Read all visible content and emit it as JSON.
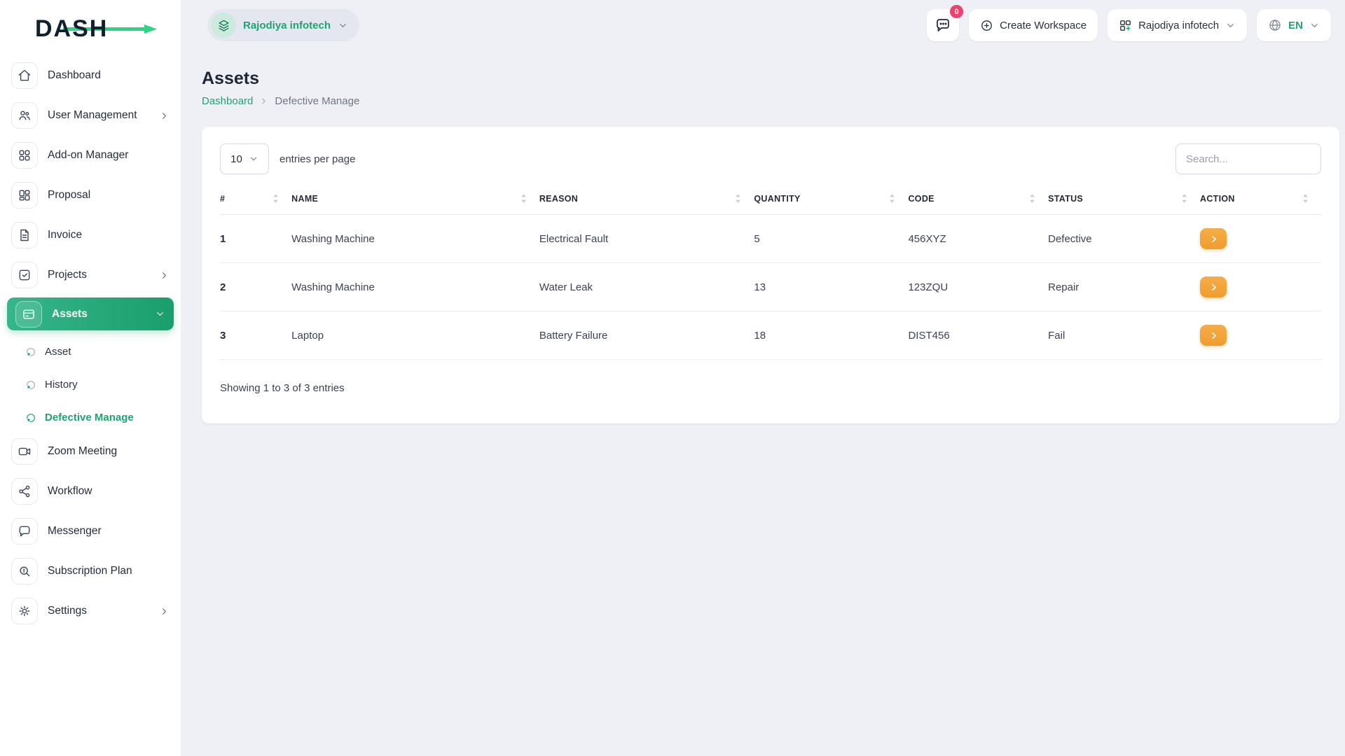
{
  "brand": {
    "name": "DASH"
  },
  "header": {
    "workspace_name": "Rajodiya infotech",
    "messages_badge": "0",
    "create_workspace_label": "Create Workspace",
    "workspace_dropdown_label": "Rajodiya infotech",
    "language": "EN"
  },
  "sidebar": {
    "items": [
      {
        "label": "Dashboard"
      },
      {
        "label": "User Management"
      },
      {
        "label": "Add-on Manager"
      },
      {
        "label": "Proposal"
      },
      {
        "label": "Invoice"
      },
      {
        "label": "Projects"
      },
      {
        "label": "Assets"
      },
      {
        "label": "Zoom Meeting"
      },
      {
        "label": "Workflow"
      },
      {
        "label": "Messenger"
      },
      {
        "label": "Subscription Plan"
      },
      {
        "label": "Settings"
      }
    ],
    "sub_items": [
      {
        "label": "Asset"
      },
      {
        "label": "History"
      },
      {
        "label": "Defective Manage"
      }
    ]
  },
  "page": {
    "title": "Assets",
    "breadcrumb_root": "Dashboard",
    "breadcrumb_current": "Defective Manage"
  },
  "table_card": {
    "entries_value": "10",
    "entries_label": "entries per page",
    "search_placeholder": "Search...",
    "columns": [
      "#",
      "NAME",
      "REASON",
      "QUANTITY",
      "CODE",
      "STATUS",
      "ACTION"
    ],
    "rows": [
      {
        "num": "1",
        "name": "Washing Machine",
        "reason": "Electrical Fault",
        "quantity": "5",
        "code": "456XYZ",
        "status": "Defective"
      },
      {
        "num": "2",
        "name": "Washing Machine",
        "reason": "Water Leak",
        "quantity": "13",
        "code": "123ZQU",
        "status": "Repair"
      },
      {
        "num": "3",
        "name": "Laptop",
        "reason": "Battery Failure",
        "quantity": "18",
        "code": "DIST456",
        "status": "Fail"
      }
    ],
    "footer": "Showing 1 to 3 of 3 entries"
  },
  "icons": {
    "sort_icon": "up-down-carets",
    "action_icon": "chevron-right"
  },
  "colors": {
    "accent_green": "#21a271",
    "action_orange": "#f2a33c",
    "badge_pink": "#f0416c"
  }
}
